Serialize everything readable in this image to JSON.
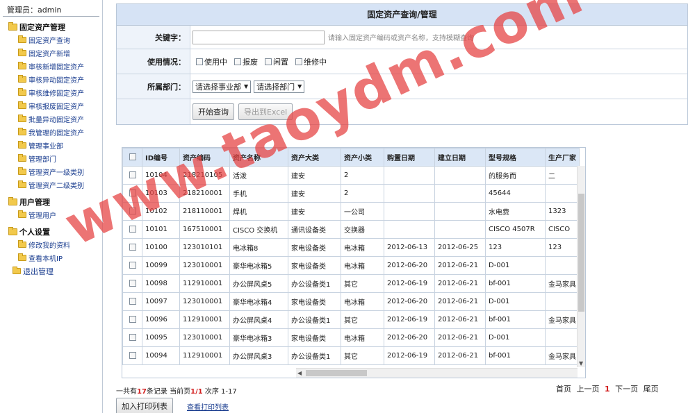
{
  "sidebar": {
    "admin": "管理员：admin",
    "groups": [
      {
        "title": "固定资产管理",
        "items": [
          "固定资产查询",
          "固定资产新增",
          "审核新增固定资产",
          "审核异动固定资产",
          "审核维修固定资产",
          "审核报废固定资产",
          "批量异动固定资产",
          "我管理的固定资产",
          "管理事业部",
          "管理部门",
          "管理资产一级类别",
          "管理资产二级类别"
        ]
      },
      {
        "title": "用户管理",
        "items": [
          "管理用户"
        ]
      },
      {
        "title": "个人设置",
        "items": [
          "修改我的资料",
          "查看本机IP"
        ]
      }
    ],
    "logout": "退出管理"
  },
  "form": {
    "title": "固定资产查询/管理",
    "keyword_label": "关键字：",
    "keyword_value": "",
    "keyword_hint": "请输入固定资产编码或资产名称，支持模糊查询",
    "usage_label": "使用情况：",
    "usage_options": [
      "使用中",
      "报废",
      "闲置",
      "维修中"
    ],
    "dept_label": "所属部门：",
    "select_division": "请选择事业部",
    "select_dept": "请选择部门",
    "search_button": "开始查询",
    "export_button": "导出到Excel"
  },
  "table": {
    "headers": [
      "ID编号",
      "资产编码",
      "资产名称",
      "资产大类",
      "资产小类",
      "购置日期",
      "建立日期",
      "型号规格",
      "生产厂家"
    ],
    "rows": [
      [
        "10104",
        "218210105",
        "活泼",
        "建安",
        "2",
        "",
        "",
        "的服务而",
        "二"
      ],
      [
        "10103",
        "218210001",
        "手机",
        "建安",
        "2",
        "",
        "",
        "45644",
        ""
      ],
      [
        "10102",
        "218110001",
        "焊机",
        "建安",
        "一公司",
        "",
        "",
        "水电费",
        "1323"
      ],
      [
        "10101",
        "167510001",
        "CISCO 交换机",
        "通讯设备类",
        "交换器",
        "",
        "",
        "CISCO 4507R",
        "CISCO"
      ],
      [
        "10100",
        "123010101",
        "电冰箱8",
        "家电设备类",
        "电冰箱",
        "2012-06-13",
        "2012-06-25",
        "123",
        "123"
      ],
      [
        "10099",
        "123010001",
        "豪华电冰箱5",
        "家电设备类",
        "电冰箱",
        "2012-06-20",
        "2012-06-21",
        "D-001",
        ""
      ],
      [
        "10098",
        "112910001",
        "办公屏风桌5",
        "办公设备类1",
        "其它",
        "2012-06-19",
        "2012-06-21",
        "bf-001",
        "金马家具"
      ],
      [
        "10097",
        "123010001",
        "豪华电冰箱4",
        "家电设备类",
        "电冰箱",
        "2012-06-20",
        "2012-06-21",
        "D-001",
        ""
      ],
      [
        "10096",
        "112910001",
        "办公屏风桌4",
        "办公设备类1",
        "其它",
        "2012-06-19",
        "2012-06-21",
        "bf-001",
        "金马家具"
      ],
      [
        "10095",
        "123010001",
        "豪华电冰箱3",
        "家电设备类",
        "电冰箱",
        "2012-06-20",
        "2012-06-21",
        "D-001",
        ""
      ],
      [
        "10094",
        "112910001",
        "办公屏风桌3",
        "办公设备类1",
        "其它",
        "2012-06-19",
        "2012-06-21",
        "bf-001",
        "金马家具"
      ]
    ]
  },
  "summary": {
    "prefix": "一共有",
    "total": "17",
    "mid": "条记录 当前页",
    "page": "1/1",
    "suffix": " 次序 1-17"
  },
  "pager": {
    "first": "首页",
    "prev": "上一页",
    "current": "1",
    "next": "下一页",
    "last": "尾页"
  },
  "bottom": {
    "add_print": "加入打印列表",
    "view_print": "查看打印列表"
  },
  "watermark": "www.taoydm.com"
}
